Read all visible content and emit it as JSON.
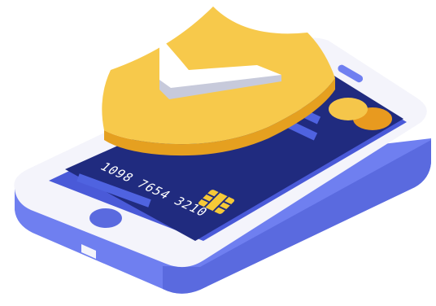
{
  "illustration": {
    "subject": "secure-mobile-payment",
    "card": {
      "number": "1098 7654 3210"
    },
    "icons": [
      "smartphone-icon",
      "credit-card-icon",
      "shield-check-icon",
      "chip-icon"
    ],
    "colors": {
      "phone_body": "#f4f4fb",
      "phone_side": "#6f7ff0",
      "phone_side_dark": "#5a6adf",
      "screen": "#4a5ad8",
      "card": "#202b7f",
      "card_stripe": "#4f63e0",
      "card_circle_left": "#f5c64a",
      "card_circle_right": "#e89a1f",
      "chip": "#f6c938",
      "shield_top": "#f7c94b",
      "shield_side": "#e5a020",
      "check_light": "#ffffff",
      "check_shadow": "#c7cadb"
    }
  }
}
